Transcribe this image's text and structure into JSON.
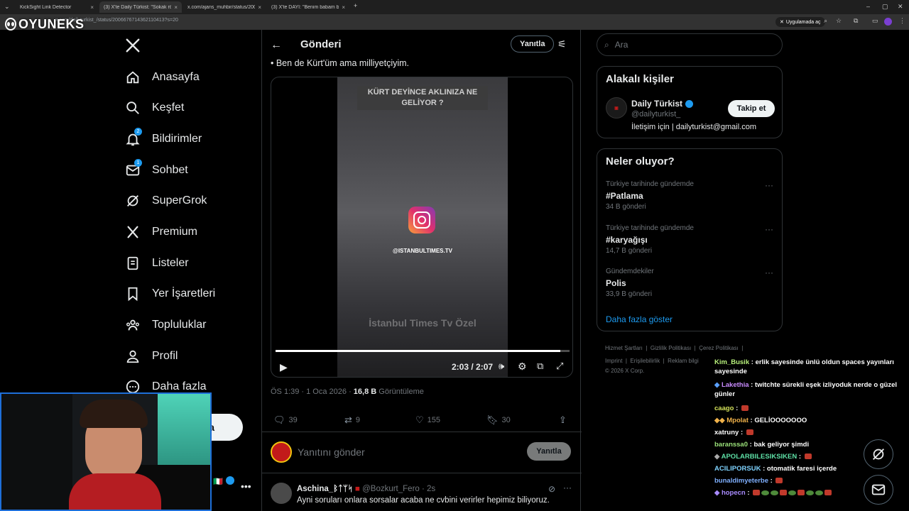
{
  "browser": {
    "tabs": [
      {
        "title": "KickSight Link Detector"
      },
      {
        "title": "(3) X'te Daily Türkist: \"Sokak rö"
      },
      {
        "title": "x.com/ajans_muhbir/status/200"
      },
      {
        "title": "(3) X'te DAYI: \"Benim babam b"
      }
    ],
    "url": "x.com/dailyturkist_/status/2006676714362110413?s=20",
    "open_in_app": "Uygulamada aç"
  },
  "watermark": "OYUNEKS",
  "nav": {
    "items": [
      {
        "label": "Anasayfa"
      },
      {
        "label": "Keşfet"
      },
      {
        "label": "Bildirimler",
        "badge": "2"
      },
      {
        "label": "Sohbet",
        "badge": "1"
      },
      {
        "label": "SuperGrok"
      },
      {
        "label": "Premium"
      },
      {
        "label": "Listeler"
      },
      {
        "label": "Yer İşaretleri"
      },
      {
        "label": "Topluluklar"
      },
      {
        "label": "Profil"
      },
      {
        "label": "Daha fazla"
      }
    ],
    "post_button": "a"
  },
  "post": {
    "header_title": "Gönderi",
    "reply_label": "Yanıtla",
    "text": "• Ben de Kürt'üm ama milliyetçiyim.",
    "video": {
      "caption_top": "KÜRT DEYİNCE AKLINIZA NE GELİYOR ?",
      "handle": "@ISTANBULTIMES.TV",
      "caption_bottom": "İstanbul Times Tv Özel",
      "time": "2:03 / 2:07",
      "progress": 0.968
    },
    "meta_time": "ÖS 1:39 · 1 Oca 2026 · ",
    "views": "16,8 B",
    "views_label": "Görüntüleme",
    "stats": {
      "replies": "39",
      "reposts": "9",
      "likes": "155",
      "bookmarks": "30"
    },
    "reply_placeholder": "Yanıtını gönder",
    "reply_button": "Yanıtla",
    "comment": {
      "name": "Aschina_ᛒᛏᛘᛋ",
      "handle": "@Bozkurt_Fero · 2s",
      "text": "Ayni soruları onlara sorsalar acaba ne cvbini verirler hepimiz biliyoruz."
    }
  },
  "right": {
    "search_placeholder": "Ara",
    "related": {
      "title": "Alakalı kişiler",
      "name": "Daily Türkist",
      "handle": "@dailyturkist_",
      "bio": "İletişim için | dailyturkist@gmail.com",
      "follow": "Takip et"
    },
    "trends": {
      "title": "Neler oluyor?",
      "items": [
        {
          "context": "Türkiye tarihinde gündemde",
          "name": "#Patlama",
          "count": "34 B gönderi"
        },
        {
          "context": "Türkiye tarihinde gündemde",
          "name": "#karyağışı",
          "count": "14,7 B gönderi"
        },
        {
          "context": "Gündemdekiler",
          "name": "Polis",
          "count": "33,9 B gönderi"
        }
      ],
      "more": "Daha fazla göster"
    },
    "footer": {
      "links": [
        "Hizmet Şartları",
        "Gizlilik Politikası",
        "Çerez Politikası",
        "Imprint",
        "Erişilebilirlik",
        "Reklam bilgi"
      ],
      "copyright": "© 2026 X Corp."
    }
  },
  "chat": [
    {
      "user": "Kim_Busik",
      "color": "#b9f27c",
      "text": "erlik sayesinde ünlü oldun spaces yayınları sayesinde"
    },
    {
      "user": "Lakethia",
      "color": "#c98bff",
      "text": "twitchte sürekli eşek izliyoduk nerde o güzel günler"
    },
    {
      "user": "caago",
      "color": "#d4e25a",
      "text": ""
    },
    {
      "user": "Mpolat",
      "color": "#f0b24a",
      "text": "GELİOOOOOOO"
    },
    {
      "user": "xatruny",
      "color": "#ffffff",
      "text": ""
    },
    {
      "user": "baranssa0",
      "color": "#9be27a",
      "text": "bak geliyor şimdi"
    },
    {
      "user": "APOLARBILESIKSIKEN",
      "color": "#5ee0a6",
      "text": ""
    },
    {
      "user": "ACILIPORSUK",
      "color": "#7fd3ff",
      "text": "otomatik faresi içerde"
    },
    {
      "user": "bunaldimyeterbe",
      "color": "#7fb0ff",
      "text": ""
    },
    {
      "user": "hopecn",
      "color": "#a98bff",
      "text": ""
    }
  ]
}
